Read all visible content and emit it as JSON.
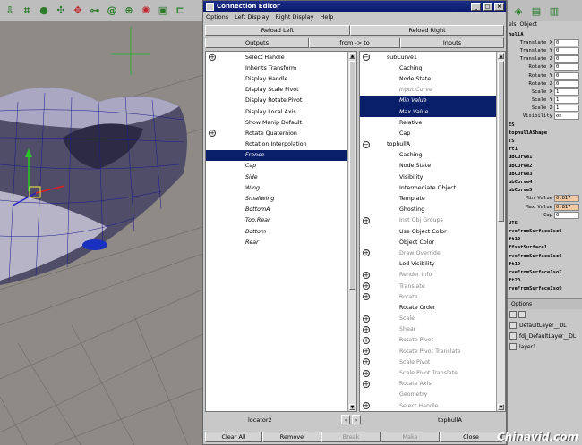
{
  "toolbar_icons": [
    "arrow-down-icon",
    "lattice-icon",
    "sphere-icon",
    "pinwheel-icon",
    "puzzle-icon",
    "link-icon",
    "spiral-icon",
    "zoom-icon",
    "wheel-icon",
    "square-icon",
    "bracket-icon"
  ],
  "window": {
    "title": "Connection Editor",
    "menus": [
      "Options",
      "Left Display",
      "Right Display",
      "Help"
    ],
    "reload_left": "Reload Left",
    "reload_right": "Reload Right",
    "outputs": "Outputs",
    "direction": "from -> to",
    "inputs": "Inputs"
  },
  "left_list": [
    {
      "label": "Select Handle",
      "exp": "+"
    },
    {
      "label": "Inherits Transform"
    },
    {
      "label": "Display Handle"
    },
    {
      "label": "Display Scale Pivot"
    },
    {
      "label": "Display Rotate Pivot"
    },
    {
      "label": "Display Local Axis"
    },
    {
      "label": "Show Manip Default"
    },
    {
      "label": "Rotate Quaternion",
      "exp": "+"
    },
    {
      "label": "Rotation Interpolation"
    },
    {
      "label": "Frence",
      "sel": true,
      "italic": true
    },
    {
      "label": "Cap",
      "italic": true
    },
    {
      "label": "Side",
      "italic": true
    },
    {
      "label": "Wing",
      "italic": true
    },
    {
      "label": "Smallwing",
      "italic": true
    },
    {
      "label": "BottomA",
      "italic": true
    },
    {
      "label": "Top.Rear",
      "italic": true
    },
    {
      "label": "Bottom",
      "italic": true
    },
    {
      "label": "Rear",
      "italic": true
    }
  ],
  "right_list": [
    {
      "label": "subCurve1",
      "exp": "−",
      "lvl": 0
    },
    {
      "label": "Caching",
      "lvl": 1
    },
    {
      "label": "Node State",
      "lvl": 1
    },
    {
      "label": "Input Curve",
      "lvl": 1,
      "italic": true,
      "dim": true
    },
    {
      "label": "Min Value",
      "lvl": 1,
      "sel": true,
      "italic": true
    },
    {
      "label": "Max Value",
      "lvl": 1,
      "sel": true,
      "italic": true
    },
    {
      "label": "Relative",
      "lvl": 1
    },
    {
      "label": "Cap",
      "lvl": 1
    },
    {
      "label": "tophullA",
      "exp": "−",
      "lvl": 0
    },
    {
      "label": "Caching",
      "lvl": 1
    },
    {
      "label": "Node State",
      "lvl": 1
    },
    {
      "label": "Visibility",
      "lvl": 1
    },
    {
      "label": "Intermediate Object",
      "lvl": 1
    },
    {
      "label": "Template",
      "lvl": 1
    },
    {
      "label": "Ghosting",
      "lvl": 1
    },
    {
      "label": "Inst Obj Groups",
      "lvl": 1,
      "exp": "+",
      "dim": true
    },
    {
      "label": "Use Object Color",
      "lvl": 1
    },
    {
      "label": "Object Color",
      "lvl": 1
    },
    {
      "label": "Draw Override",
      "lvl": 1,
      "exp": "+",
      "dim": true
    },
    {
      "label": "Lod Visibility",
      "lvl": 1
    },
    {
      "label": "Render Info",
      "lvl": 1,
      "exp": "+",
      "dim": true
    },
    {
      "label": "Translate",
      "lvl": 1,
      "exp": "+",
      "dim": true
    },
    {
      "label": "Rotate",
      "lvl": 1,
      "exp": "+",
      "dim": true
    },
    {
      "label": "Rotate Order",
      "lvl": 1
    },
    {
      "label": "Scale",
      "lvl": 1,
      "exp": "+",
      "dim": true
    },
    {
      "label": "Shear",
      "lvl": 1,
      "exp": "+",
      "dim": true
    },
    {
      "label": "Rotate Pivot",
      "lvl": 1,
      "exp": "+",
      "dim": true
    },
    {
      "label": "Rotate Pivot Translate",
      "lvl": 1,
      "exp": "+",
      "dim": true
    },
    {
      "label": "Scale Pivot",
      "lvl": 1,
      "exp": "+",
      "dim": true
    },
    {
      "label": "Scale Pivot Translate",
      "lvl": 1,
      "exp": "+",
      "dim": true
    },
    {
      "label": "Rotate Axis",
      "lvl": 1,
      "exp": "+",
      "dim": true
    },
    {
      "label": "Geometry",
      "lvl": 1,
      "dim": true
    },
    {
      "label": "Select Handle",
      "lvl": 1,
      "exp": "+",
      "dim": true
    }
  ],
  "left_node": "locator2",
  "right_node": "tophullA",
  "bottom_buttons": [
    "Clear All",
    "Remove",
    "Break",
    "Make",
    "Close"
  ],
  "side": {
    "tabs": [
      "els",
      "Object"
    ],
    "node_name": "hullA",
    "channels": [
      {
        "name": "Translate X",
        "value": "0"
      },
      {
        "name": "Translate Y",
        "value": "0"
      },
      {
        "name": "Translate Z",
        "value": "0"
      },
      {
        "name": "Rotate X",
        "value": "0"
      },
      {
        "name": "Rotate Y",
        "value": "0"
      },
      {
        "name": "Rotate Z",
        "value": "0"
      },
      {
        "name": "Scale X",
        "value": "1"
      },
      {
        "name": "Scale Y",
        "value": "1"
      },
      {
        "name": "Scale Z",
        "value": "1"
      },
      {
        "name": "Visibility",
        "value": "on"
      }
    ],
    "shapes_header": "ES",
    "shape_node": "tophullAShape",
    "inputs_header": "TS",
    "inputs": [
      "ft1",
      "ubCurve1",
      "ubCurve2",
      "ubCurve3",
      "ubCurve4",
      "ubCurve5"
    ],
    "subcurve_channels": [
      {
        "name": "Min Value",
        "value": "0.817"
      },
      {
        "name": "Max Value",
        "value": "0.817"
      },
      {
        "name": "Cap",
        "value": "0"
      }
    ],
    "outputs_header": "UTS",
    "outputs": [
      "rveFromSurfaceIso6",
      "ft10",
      "ffsetSurface1",
      "rveFromSurfaceIso6",
      "ft19",
      "rveFromSurfaceIso7",
      "ft20",
      "rveFromSurfaceIso9"
    ],
    "options_label": "Options",
    "layers": [
      "DefaultLayer__DL",
      "fdj_DefaultLayer__DL",
      "layer1"
    ]
  },
  "watermark": "Chinavid.com"
}
